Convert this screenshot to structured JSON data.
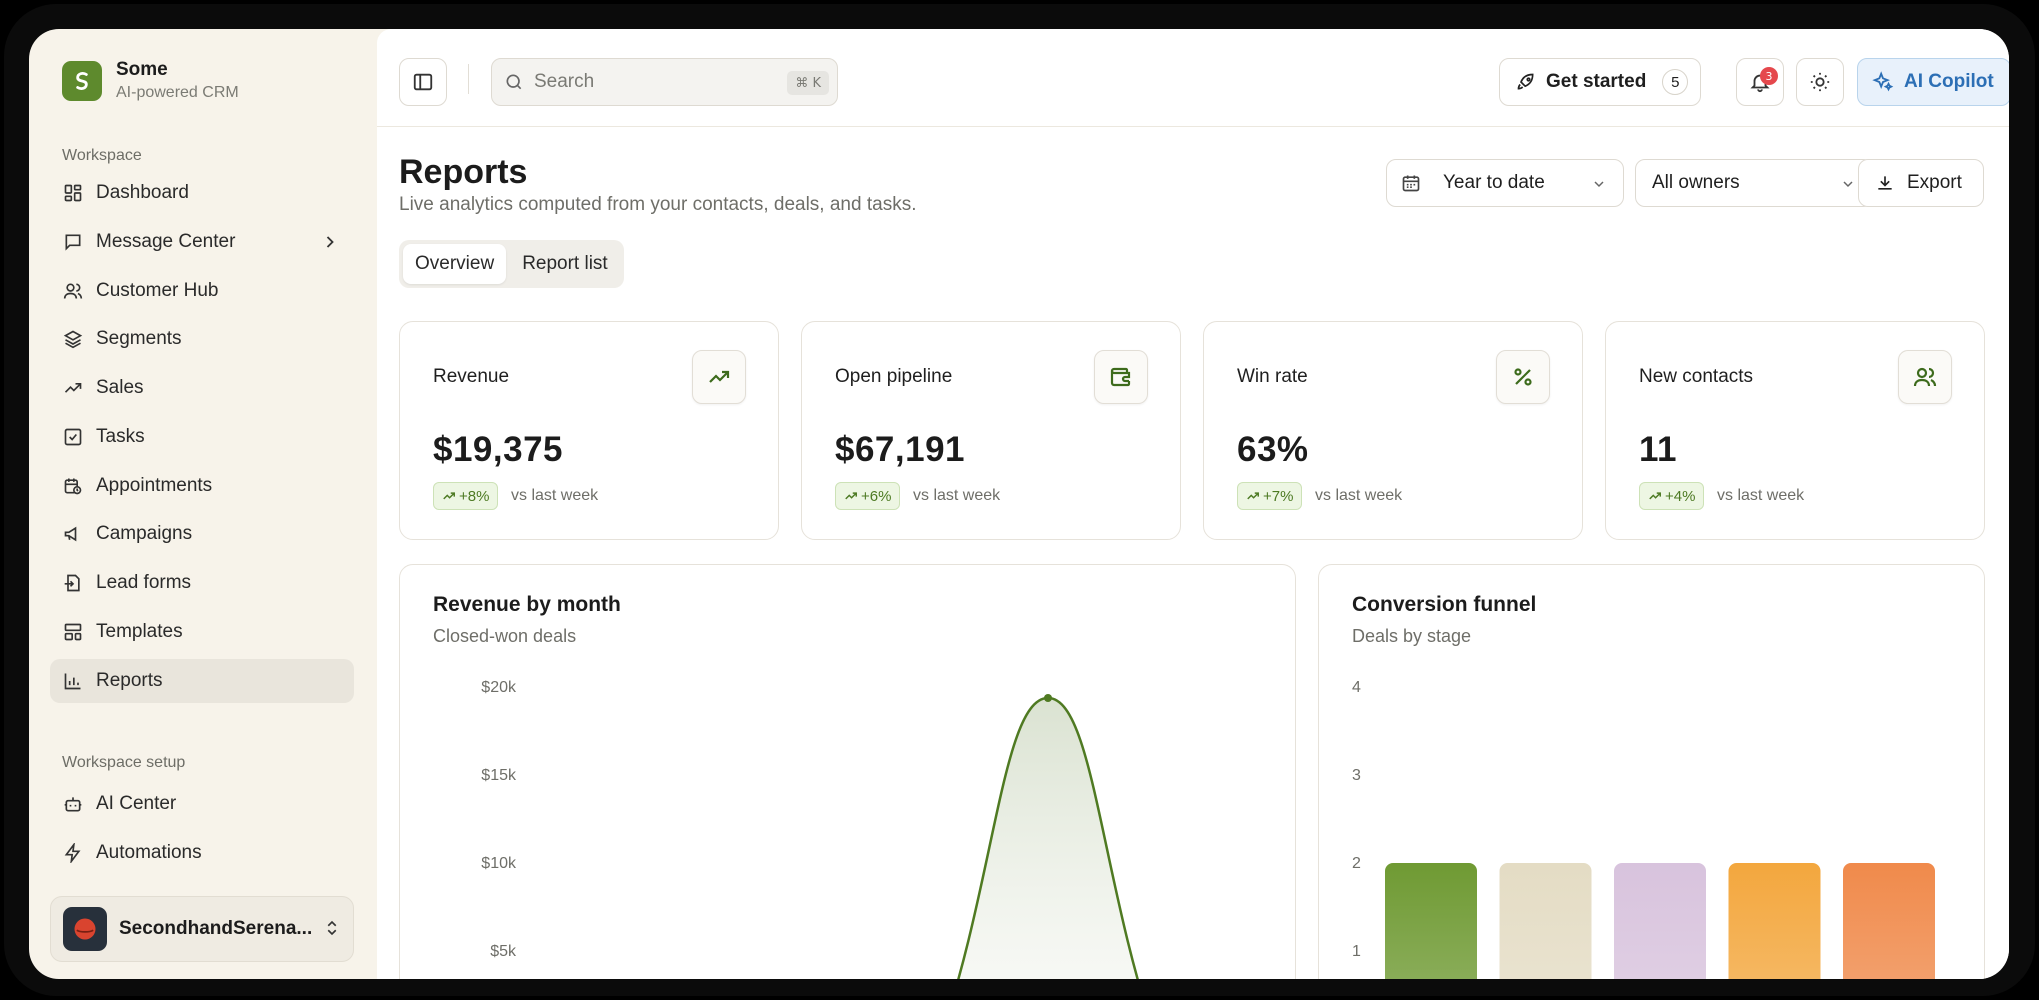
{
  "brand": {
    "name": "Some",
    "tagline": "AI-powered CRM"
  },
  "sidebar": {
    "workspace_label": "Workspace",
    "items": [
      {
        "label": "Dashboard",
        "icon": "dashboard-icon"
      },
      {
        "label": "Message Center",
        "icon": "message-icon",
        "has_submenu": true
      },
      {
        "label": "Customer Hub",
        "icon": "users-icon"
      },
      {
        "label": "Segments",
        "icon": "layers-icon"
      },
      {
        "label": "Sales",
        "icon": "trending-up-icon"
      },
      {
        "label": "Tasks",
        "icon": "checkbox-icon"
      },
      {
        "label": "Appointments",
        "icon": "calendar-clock-icon"
      },
      {
        "label": "Campaigns",
        "icon": "megaphone-icon"
      },
      {
        "label": "Lead forms",
        "icon": "form-icon"
      },
      {
        "label": "Templates",
        "icon": "template-icon"
      },
      {
        "label": "Reports",
        "icon": "bar-chart-icon",
        "active": true
      }
    ],
    "setup_label": "Workspace setup",
    "setup_items": [
      {
        "label": "AI Center",
        "icon": "bot-icon"
      },
      {
        "label": "Automations",
        "icon": "zap-icon"
      }
    ],
    "account": {
      "name": "SecondhandSerena..."
    }
  },
  "topbar": {
    "search_placeholder": "Search",
    "search_shortcut": "⌘ K",
    "get_started_label": "Get started",
    "get_started_count": "5",
    "notification_count": "3",
    "copilot_label": "AI Copilot"
  },
  "page": {
    "title": "Reports",
    "subtitle": "Live analytics computed from your contacts, deals, and tasks.",
    "date_filter": "Year to date",
    "owner_filter": "All owners",
    "export_label": "Export",
    "tabs": [
      {
        "label": "Overview",
        "active": true
      },
      {
        "label": "Report list",
        "active": false
      }
    ]
  },
  "stats": [
    {
      "label": "Revenue",
      "value": "$19,375",
      "delta": "+8%",
      "compare": "vs last week",
      "icon": "trending-up-icon"
    },
    {
      "label": "Open pipeline",
      "value": "$67,191",
      "delta": "+6%",
      "compare": "vs last week",
      "icon": "wallet-icon"
    },
    {
      "label": "Win rate",
      "value": "63%",
      "delta": "+7%",
      "compare": "vs last week",
      "icon": "percent-icon"
    },
    {
      "label": "New contacts",
      "value": "11",
      "delta": "+4%",
      "compare": "vs last week",
      "icon": "users-icon"
    }
  ],
  "colors": {
    "accent": "#5e8a2d",
    "copilot": "#2c6fb5",
    "badge": "#e5484d",
    "funnel": [
      "#6f9a33",
      "#e4dcc4",
      "#d8c3dd",
      "#f3a73e",
      "#f08a4b"
    ]
  },
  "chart_data": [
    {
      "type": "area",
      "title": "Revenue by month",
      "subtitle": "Closed-won deals",
      "y_ticks": [
        "$20k",
        "$15k",
        "$10k",
        "$5k"
      ],
      "y_tick_values": [
        20000,
        15000,
        10000,
        5000
      ],
      "peak_value": 19375,
      "grid": false,
      "note": "Single peak at the center of the visible x-range; lower portion and x-axis cropped"
    },
    {
      "type": "bar",
      "title": "Conversion funnel",
      "subtitle": "Deals by stage",
      "y_ticks": [
        "4",
        "3",
        "2",
        "1"
      ],
      "y_tick_values": [
        4,
        3,
        2,
        1
      ],
      "values": [
        2,
        2,
        2,
        2,
        2
      ],
      "grid": false
    }
  ]
}
